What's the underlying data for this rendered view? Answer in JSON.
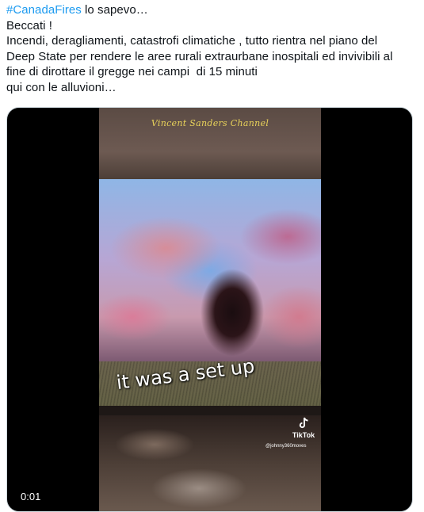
{
  "tweet": {
    "hashtag": "#CanadaFires",
    "line1_rest": " lo sapevo…",
    "line2": "Beccati !",
    "line3": "Incendi, deragliamenti, catastrofi climatiche , tutto rientra nel piano del",
    "line4": "Deep State per rendere le aree rurali extraurbane inospitali ed invivibili al",
    "line5": "fine di dirottare il gregge nei campi  di 15 minuti",
    "line6": "qui con le alluvioni…"
  },
  "video": {
    "channel_title": "Vincent Sanders Channel",
    "caption": "it was a set up",
    "tiktok_label": "TikTok",
    "tiktok_handle": "@johnny360moves",
    "duration": "0:01"
  },
  "colors": {
    "hashtag": "#1d9bf0",
    "text": "#0f1419",
    "channel_title": "#e8d25a"
  }
}
